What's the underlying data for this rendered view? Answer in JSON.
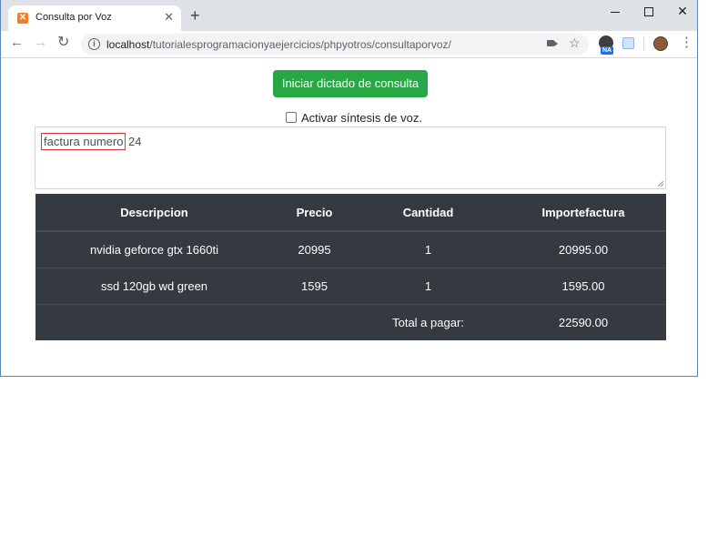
{
  "browser": {
    "tab_title": "Consulta por Voz",
    "tab_favicon": "xampp-icon",
    "url_host": "localhost",
    "url_path": "/tutorialesprogramacionyaejercicios/phpyotros/consultaporvoz/",
    "extension_badge": "NA"
  },
  "page": {
    "start_button_label": "Iniciar dictado de consulta",
    "synthesis_label": "Activar síntesis de voz.",
    "synthesis_checked": false,
    "query_highlight": "factura numero",
    "query_rest": " 24",
    "table": {
      "headers": {
        "descripcion": "Descripcion",
        "precio": "Precio",
        "cantidad": "Cantidad",
        "importe": "Importefactura"
      },
      "rows": [
        {
          "descripcion": "nvidia geforce gtx 1660ti",
          "precio": "20995",
          "cantidad": "1",
          "importe": "20995.00"
        },
        {
          "descripcion": "ssd 120gb wd green",
          "precio": "1595",
          "cantidad": "1",
          "importe": "1595.00"
        }
      ],
      "total_label": "Total a pagar:",
      "total_value": "22590.00"
    }
  },
  "colors": {
    "accent_button": "#28a745",
    "table_bg": "#343a40",
    "highlight_border": "#e03131"
  }
}
